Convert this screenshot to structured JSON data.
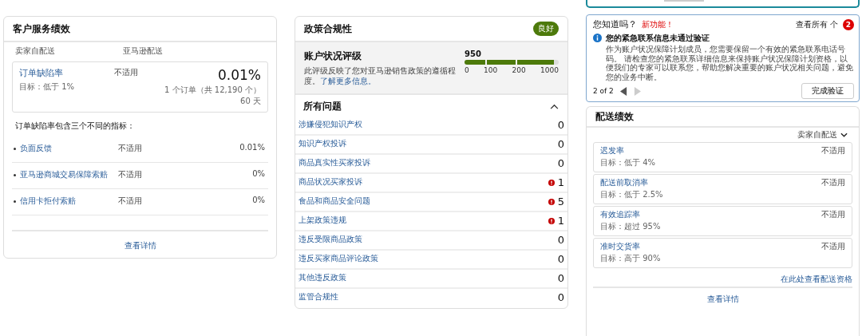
{
  "customer_service": {
    "title": "客户服务绩效",
    "columns": [
      "卖家自配送",
      "亚马逊配送"
    ],
    "odr": {
      "name": "订单缺陷率",
      "target": "目标：低于 1%",
      "mfn": "不适用",
      "value": "0.01%",
      "orders": "1 个订单（共 12,190 个）",
      "period": "60 天"
    },
    "intro": "订单缺陷率包含三个不同的指标：",
    "metrics": [
      {
        "name": "负面反馈",
        "mfn": "不适用",
        "afn": "0.01%"
      },
      {
        "name": "亚马逊商城交易保障索赔",
        "mfn": "不适用",
        "afn": "0%"
      },
      {
        "name": "信用卡拒付索赔",
        "mfn": "不适用",
        "afn": "0%"
      }
    ],
    "details_link": "查看详情"
  },
  "policy": {
    "title": "政策合规性",
    "status": "良好",
    "rating": {
      "title": "账户状况评级",
      "description": "此评级反映了您对亚马逊销售政策的遵循程度。",
      "link": "了解更多信息。",
      "score": "950",
      "level": 0.95,
      "ticks": [
        "0",
        "100",
        "200",
        "1000"
      ]
    },
    "issues_title": "所有问题",
    "expanded": true,
    "issues": [
      {
        "name": "涉嫌侵犯知识产权",
        "count": "0",
        "alert": false
      },
      {
        "name": "知识产权投诉",
        "count": "0",
        "alert": false
      },
      {
        "name": "商品真实性买家投诉",
        "count": "0",
        "alert": false
      },
      {
        "name": "商品状况买家投诉",
        "count": "1",
        "alert": true
      },
      {
        "name": "食品和商品安全问题",
        "count": "5",
        "alert": true
      },
      {
        "name": "上架政策违规",
        "count": "1",
        "alert": true
      },
      {
        "name": "违反受限商品政策",
        "count": "0",
        "alert": false
      },
      {
        "name": "违反买家商品评论政策",
        "count": "0",
        "alert": false
      },
      {
        "name": "其他违反政策",
        "count": "0",
        "alert": false
      },
      {
        "name": "监管合规性",
        "count": "0",
        "alert": false
      }
    ]
  },
  "notice": {
    "title": "您知道吗？",
    "badge": "新功能！",
    "view_all": "查看所有 个",
    "count": "2",
    "heading": "您的紧急联系信息未通过验证",
    "body": "作为账户状况保障计划成员，您需要保留一个有效的紧急联系电话号码。 请检查您的紧急联系详细信息来保持账户状况保障计划资格，以便我们的专家可以联系您，帮助您解决重要的账户状况相关问题，避免您的业务中断。",
    "pager": "2 of 2",
    "prev_disabled": false,
    "next_disabled": true,
    "button": "完成验证"
  },
  "shipping": {
    "title": "配送绩效",
    "filter": "卖家自配送",
    "metrics": [
      {
        "name": "迟发率",
        "target": "目标：低于 4%",
        "value": "不适用"
      },
      {
        "name": "配送前取消率",
        "target": "目标：低于 2.5%",
        "value": "不适用"
      },
      {
        "name": "有效追踪率",
        "target": "目标：超过 95%",
        "value": "不适用"
      },
      {
        "name": "准时交货率",
        "target": "目标：高于 90%",
        "value": "不适用"
      }
    ],
    "eligibility_link": "在此处查看配送资格",
    "details_link": "查看详情"
  }
}
